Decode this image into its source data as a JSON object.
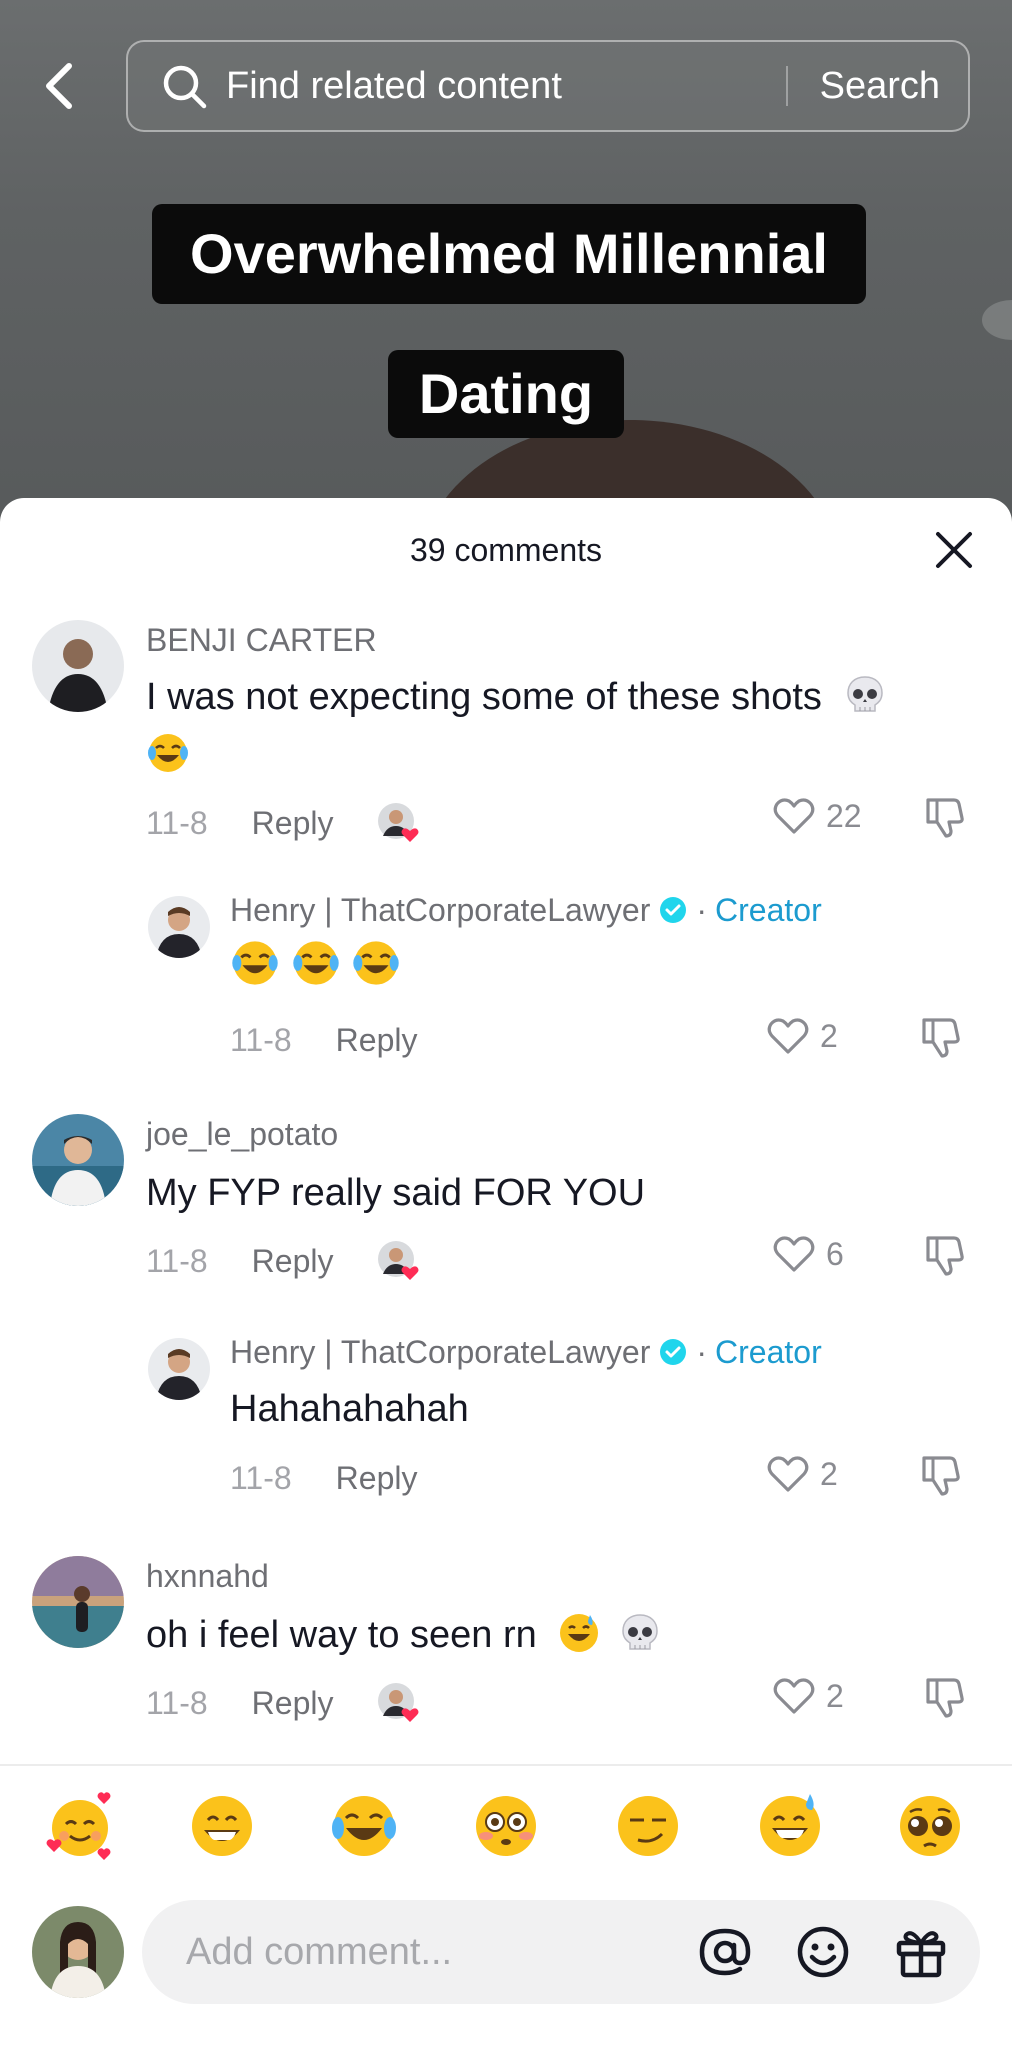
{
  "video": {
    "captions": [
      "Overwhelmed Millennial",
      "Dating"
    ]
  },
  "search": {
    "placeholder": "Find related content",
    "button_label": "Search"
  },
  "sheet": {
    "title": "39 comments"
  },
  "comments": [
    {
      "username": "BENJI CARTER",
      "text": "I was not expecting some of these shots",
      "emojis": [
        "skull",
        "face-with-tears-of-joy"
      ],
      "date": "11-8",
      "reply_label": "Reply",
      "likes": "22",
      "liked_by_creator": true
    },
    {
      "username": "Henry | ThatCorporateLawyer",
      "badge": "Creator",
      "separator": "·",
      "text": "",
      "emojis": [
        "face-with-tears-of-joy",
        "face-with-tears-of-joy",
        "face-with-tears-of-joy"
      ],
      "date": "11-8",
      "reply_label": "Reply",
      "likes": "2"
    },
    {
      "username": "joe_le_potato",
      "text": "My FYP really said FOR YOU",
      "date": "11-8",
      "reply_label": "Reply",
      "likes": "6",
      "liked_by_creator": true
    },
    {
      "username": "Henry | ThatCorporateLawyer",
      "badge": "Creator",
      "separator": "·",
      "text": "Hahahahahah",
      "date": "11-8",
      "reply_label": "Reply",
      "likes": "2"
    },
    {
      "username": "hxnnahd",
      "text": "oh i feel way to seen rn",
      "emojis": [
        "grinning-face-with-sweat",
        "skull"
      ],
      "date": "11-8",
      "reply_label": "Reply",
      "likes": "2",
      "liked_by_creator": true
    }
  ],
  "quick_emojis": [
    "smiling-face-with-hearts",
    "grinning-face",
    "face-with-tears-of-joy",
    "flushed-face",
    "smirking-face",
    "grinning-face-with-sweat",
    "pleading-face"
  ],
  "composer": {
    "placeholder": "Add comment..."
  },
  "colors": {
    "creator_accent": "#1c9bcf",
    "like_heart": "#fe2c55",
    "text_primary": "#161823",
    "text_secondary": "#6e6f74"
  }
}
